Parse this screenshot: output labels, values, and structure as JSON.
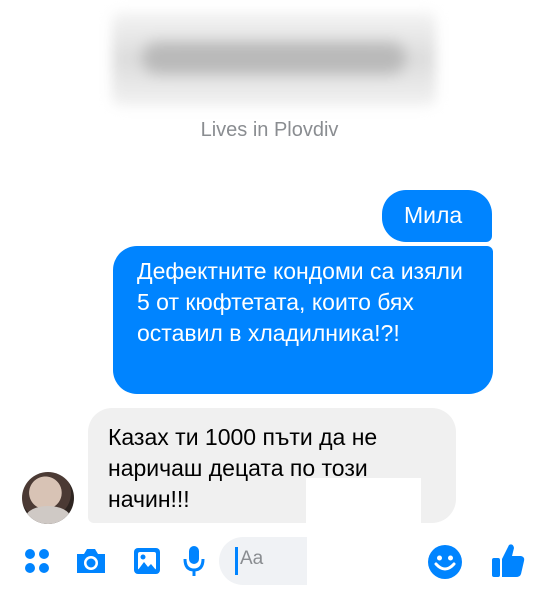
{
  "profile": {
    "lives_in": "Lives in Plovdiv"
  },
  "messages": [
    {
      "direction": "outgoing",
      "text": "Мила"
    },
    {
      "direction": "outgoing",
      "text": "Дефектните кондоми са изяли 5 от кюфтетата, които бях оставил в хладилника!?!"
    },
    {
      "direction": "incoming",
      "text": "Казах ти 1000 пъти да не наричаш децата по този начин!!!"
    }
  ],
  "composer": {
    "placeholder": "Aa"
  },
  "colors": {
    "accent": "#0084ff",
    "incoming_bubble": "#f0f0f0",
    "muted_text": "#8a8d91"
  },
  "icons": [
    "menu-dots-icon",
    "camera-icon",
    "gallery-icon",
    "microphone-icon",
    "emoji-icon",
    "thumbs-up-icon"
  ]
}
